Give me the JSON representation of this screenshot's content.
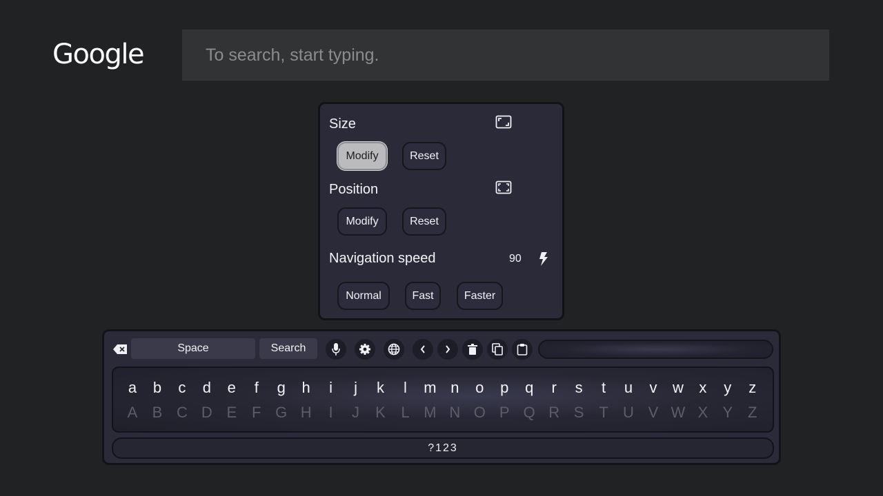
{
  "header": {
    "logo_text": "Google",
    "search_placeholder": "To search, start typing."
  },
  "panel": {
    "size": {
      "title": "Size",
      "icon": "resize-icon",
      "buttons": [
        {
          "label": "Modify",
          "active": true
        },
        {
          "label": "Reset",
          "active": false
        }
      ]
    },
    "position": {
      "title": "Position",
      "icon": "move-icon",
      "buttons": [
        {
          "label": "Modify",
          "active": false
        },
        {
          "label": "Reset",
          "active": false
        }
      ]
    },
    "navigation_speed": {
      "title": "Navigation speed",
      "value": "90",
      "icon": "lightning-icon",
      "buttons": [
        {
          "label": "Normal"
        },
        {
          "label": "Fast"
        },
        {
          "label": "Faster"
        }
      ]
    }
  },
  "keyboard": {
    "toolbar": {
      "space_label": "Space",
      "search_label": "Search",
      "icons": [
        "backspace-icon",
        "mic-icon",
        "gear-icon",
        "globe-icon",
        "chevron-left-icon",
        "chevron-right-icon",
        "trash-icon",
        "copy-icon",
        "clipboard-icon"
      ]
    },
    "lower_keys": [
      "a",
      "b",
      "c",
      "d",
      "e",
      "f",
      "g",
      "h",
      "i",
      "j",
      "k",
      "l",
      "m",
      "n",
      "o",
      "p",
      "q",
      "r",
      "s",
      "t",
      "u",
      "v",
      "w",
      "x",
      "y",
      "z"
    ],
    "upper_keys": [
      "A",
      "B",
      "C",
      "D",
      "E",
      "F",
      "G",
      "H",
      "I",
      "J",
      "K",
      "L",
      "M",
      "N",
      "O",
      "P",
      "Q",
      "R",
      "S",
      "T",
      "U",
      "V",
      "W",
      "X",
      "Y",
      "Z"
    ],
    "numbers_label": "?123"
  },
  "colors": {
    "background": "#212224",
    "panel": "#2a2a38",
    "active_button": "#bbbbbd"
  }
}
